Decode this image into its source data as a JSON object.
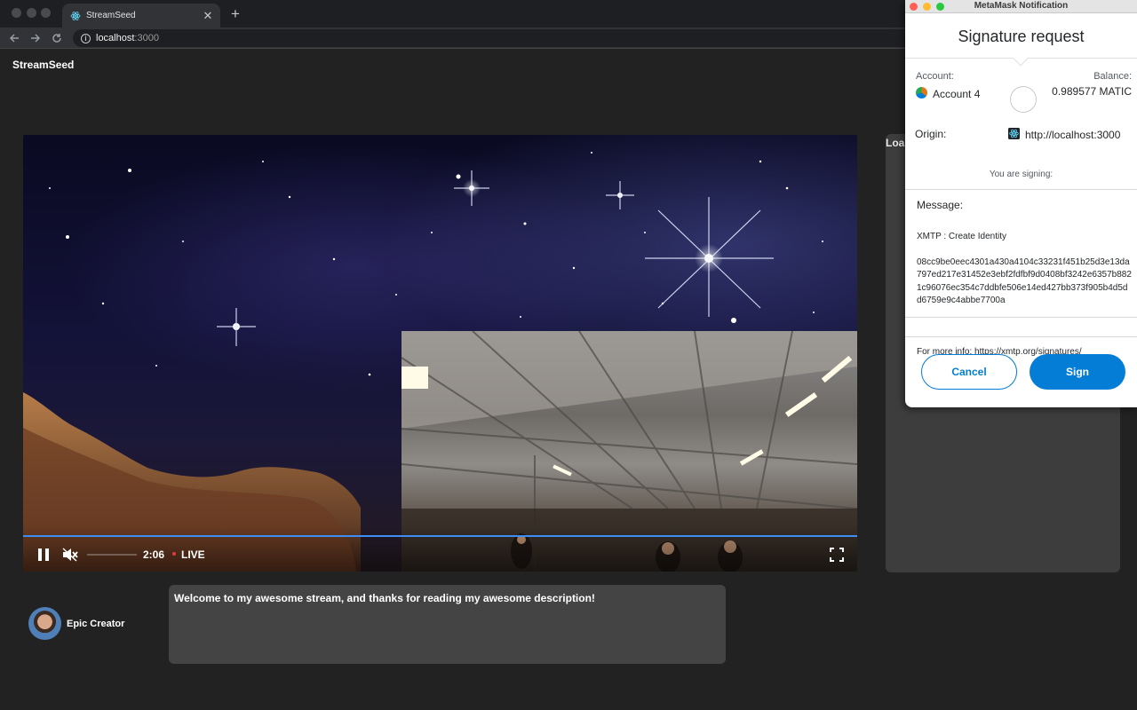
{
  "browser": {
    "tab_title": "StreamSeed",
    "url_host": "localhost",
    "url_port": ":3000",
    "icons": [
      "react-favicon",
      "close-icon",
      "plus-icon",
      "back-arrow-icon",
      "forward-arrow-icon",
      "reload-icon",
      "info-icon"
    ]
  },
  "app": {
    "title": "StreamSeed"
  },
  "player": {
    "time": "2:06",
    "live_label": "LIVE",
    "progress": 1.0,
    "muted": true,
    "accent_color": "#3d8df5",
    "live_dot_color": "#e23b3b",
    "icons": [
      "pause-icon",
      "mute-icon",
      "fullscreen-icon"
    ]
  },
  "side_panel": {
    "loading_text": "Loa"
  },
  "creator": {
    "name": "Epic Creator",
    "description": "Welcome to my awesome stream, and thanks for reading my awesome description!"
  },
  "metamask": {
    "window_title": "MetaMask Notification",
    "heading": "Signature request",
    "account_label": "Account:",
    "account_name": "Account 4",
    "balance_label": "Balance:",
    "balance_value": "0.989577 MATIC",
    "origin_label": "Origin:",
    "origin_value": "http://localhost:3000",
    "signing_text": "You are signing:",
    "message_label": "Message:",
    "message_line1": "XMTP : Create Identity",
    "message_hex": "08cc9be0eec4301a430a4104c33231f451b25d3e13da797ed217e31452e3ebf2fdfbf9d0408bf3242e6357b8821c96076ec354c7ddbfe506e14ed427bb373f905b4d5dd6759e9c4abbe7700a",
    "message_info": "For more info: https://xmtp.org/signatures/",
    "cancel_label": "Cancel",
    "sign_label": "Sign",
    "accent_color": "#037dd6"
  }
}
